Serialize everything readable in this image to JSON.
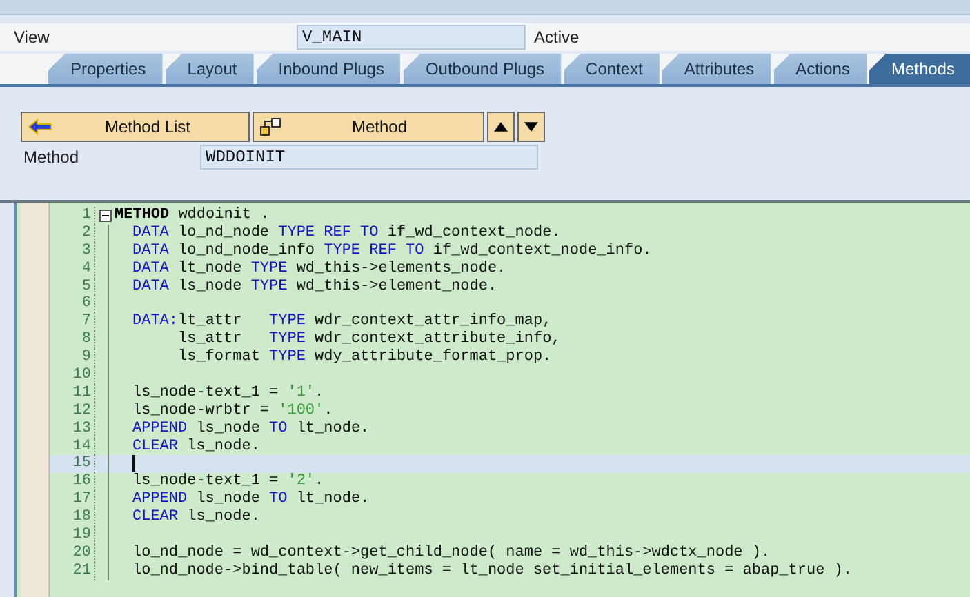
{
  "view": {
    "label": "View",
    "value": "V_MAIN",
    "status": "Active"
  },
  "tabs": [
    {
      "label": "Properties",
      "selected": false
    },
    {
      "label": "Layout",
      "selected": false
    },
    {
      "label": "Inbound Plugs",
      "selected": false
    },
    {
      "label": "Outbound Plugs",
      "selected": false
    },
    {
      "label": "Context",
      "selected": false
    },
    {
      "label": "Attributes",
      "selected": false
    },
    {
      "label": "Actions",
      "selected": false
    },
    {
      "label": "Methods",
      "selected": true
    }
  ],
  "toolbar": {
    "buttons": [
      {
        "kind": "back",
        "label": "Method List"
      },
      {
        "kind": "method",
        "label": "Method"
      },
      {
        "kind": "up"
      },
      {
        "kind": "down"
      }
    ]
  },
  "method": {
    "label": "Method",
    "value": "WDDOINIT"
  },
  "editor": {
    "lines": [
      {
        "number": "1",
        "current": false,
        "tokens": [
          {
            "kind": "head",
            "text": "METHOD"
          },
          {
            "kind": "text",
            "text": " wddoinit ."
          }
        ],
        "children": [
          {
            "number": "2",
            "current": false,
            "tokens": [
              {
                "kind": "kw",
                "text": "DATA"
              },
              {
                "kind": "text",
                "text": " lo_nd_node "
              },
              {
                "kind": "kw",
                "text": "TYPE REF TO"
              },
              {
                "kind": "text",
                "text": " if_wd_context_node."
              }
            ]
          },
          {
            "number": "3",
            "current": false,
            "tokens": [
              {
                "kind": "kw",
                "text": "DATA"
              },
              {
                "kind": "text",
                "text": " lo_nd_node_info "
              },
              {
                "kind": "kw",
                "text": "TYPE REF TO"
              },
              {
                "kind": "text",
                "text": " if_wd_context_node_info."
              }
            ]
          },
          {
            "number": "4",
            "current": false,
            "tokens": [
              {
                "kind": "kw",
                "text": "DATA"
              },
              {
                "kind": "text",
                "text": " lt_node "
              },
              {
                "kind": "kw",
                "text": "TYPE"
              },
              {
                "kind": "text",
                "text": " wd_this->elements_node."
              }
            ]
          },
          {
            "number": "5",
            "current": false,
            "tokens": [
              {
                "kind": "kw",
                "text": "DATA"
              },
              {
                "kind": "text",
                "text": " ls_node "
              },
              {
                "kind": "kw",
                "text": "TYPE"
              },
              {
                "kind": "text",
                "text": " wd_this->element_node."
              }
            ]
          },
          {
            "number": "6",
            "current": false
          },
          {
            "number": "7",
            "current": false,
            "tokens": [
              {
                "kind": "kw",
                "text": "DATA:"
              },
              {
                "kind": "text",
                "text": "lt_attr   "
              },
              {
                "kind": "kw",
                "text": "TYPE"
              },
              {
                "kind": "text",
                "text": " wdr_context_attr_info_map,"
              }
            ]
          },
          {
            "number": "8",
            "current": false,
            "tokens": [
              {
                "kind": "text",
                "text": "     ls_attr   "
              },
              {
                "kind": "kw",
                "text": "TYPE"
              },
              {
                "kind": "text",
                "text": " wdr_context_attribute_info,"
              }
            ]
          },
          {
            "number": "9",
            "current": false,
            "tokens": [
              {
                "kind": "text",
                "text": "     ls_format "
              },
              {
                "kind": "kw",
                "text": "TYPE"
              },
              {
                "kind": "text",
                "text": " wdy_attribute_format_prop."
              }
            ]
          },
          {
            "number": "10",
            "current": false
          },
          {
            "number": "11",
            "current": false,
            "tokens": [
              {
                "kind": "text",
                "text": "ls_node-text_1 = "
              },
              {
                "kind": "str",
                "text": "'1'"
              },
              {
                "kind": "text",
                "text": "."
              }
            ]
          },
          {
            "number": "12",
            "current": false,
            "tokens": [
              {
                "kind": "text",
                "text": "ls_node-wrbtr = "
              },
              {
                "kind": "str",
                "text": "'100'"
              },
              {
                "kind": "text",
                "text": "."
              }
            ]
          },
          {
            "number": "13",
            "current": false,
            "tokens": [
              {
                "kind": "kw",
                "text": "APPEND"
              },
              {
                "kind": "text",
                "text": " ls_node "
              },
              {
                "kind": "kw",
                "text": "TO"
              },
              {
                "kind": "text",
                "text": " lt_node."
              }
            ]
          },
          {
            "number": "14",
            "current": false,
            "tokens": [
              {
                "kind": "kw",
                "text": "CLEAR"
              },
              {
                "kind": "text",
                "text": " ls_node."
              }
            ]
          },
          {
            "number": "15",
            "current": true
          },
          {
            "number": "16",
            "current": false,
            "tokens": [
              {
                "kind": "text",
                "text": "ls_node-text_1 = "
              },
              {
                "kind": "str",
                "text": "'2'"
              },
              {
                "kind": "text",
                "text": "."
              }
            ]
          },
          {
            "number": "17",
            "current": false,
            "tokens": [
              {
                "kind": "kw",
                "text": "APPEND"
              },
              {
                "kind": "text",
                "text": " ls_node "
              },
              {
                "kind": "kw",
                "text": "TO"
              },
              {
                "kind": "text",
                "text": " lt_node."
              }
            ]
          },
          {
            "number": "18",
            "current": false,
            "tokens": [
              {
                "kind": "kw",
                "text": "CLEAR"
              },
              {
                "kind": "text",
                "text": " ls_node."
              }
            ]
          },
          {
            "number": "19",
            "current": false
          },
          {
            "number": "20",
            "current": false,
            "tokens": [
              {
                "kind": "text",
                "text": "lo_nd_node = wd_context->get_child_node( name = wd_this->wdctx_node )."
              }
            ]
          },
          {
            "number": "21",
            "current": false,
            "tokens": [
              {
                "kind": "text",
                "text": "lo_nd_node->bind_table( new_items = lt_node set_initial_elements = abap_true )."
              }
            ]
          }
        ]
      }
    ]
  }
}
